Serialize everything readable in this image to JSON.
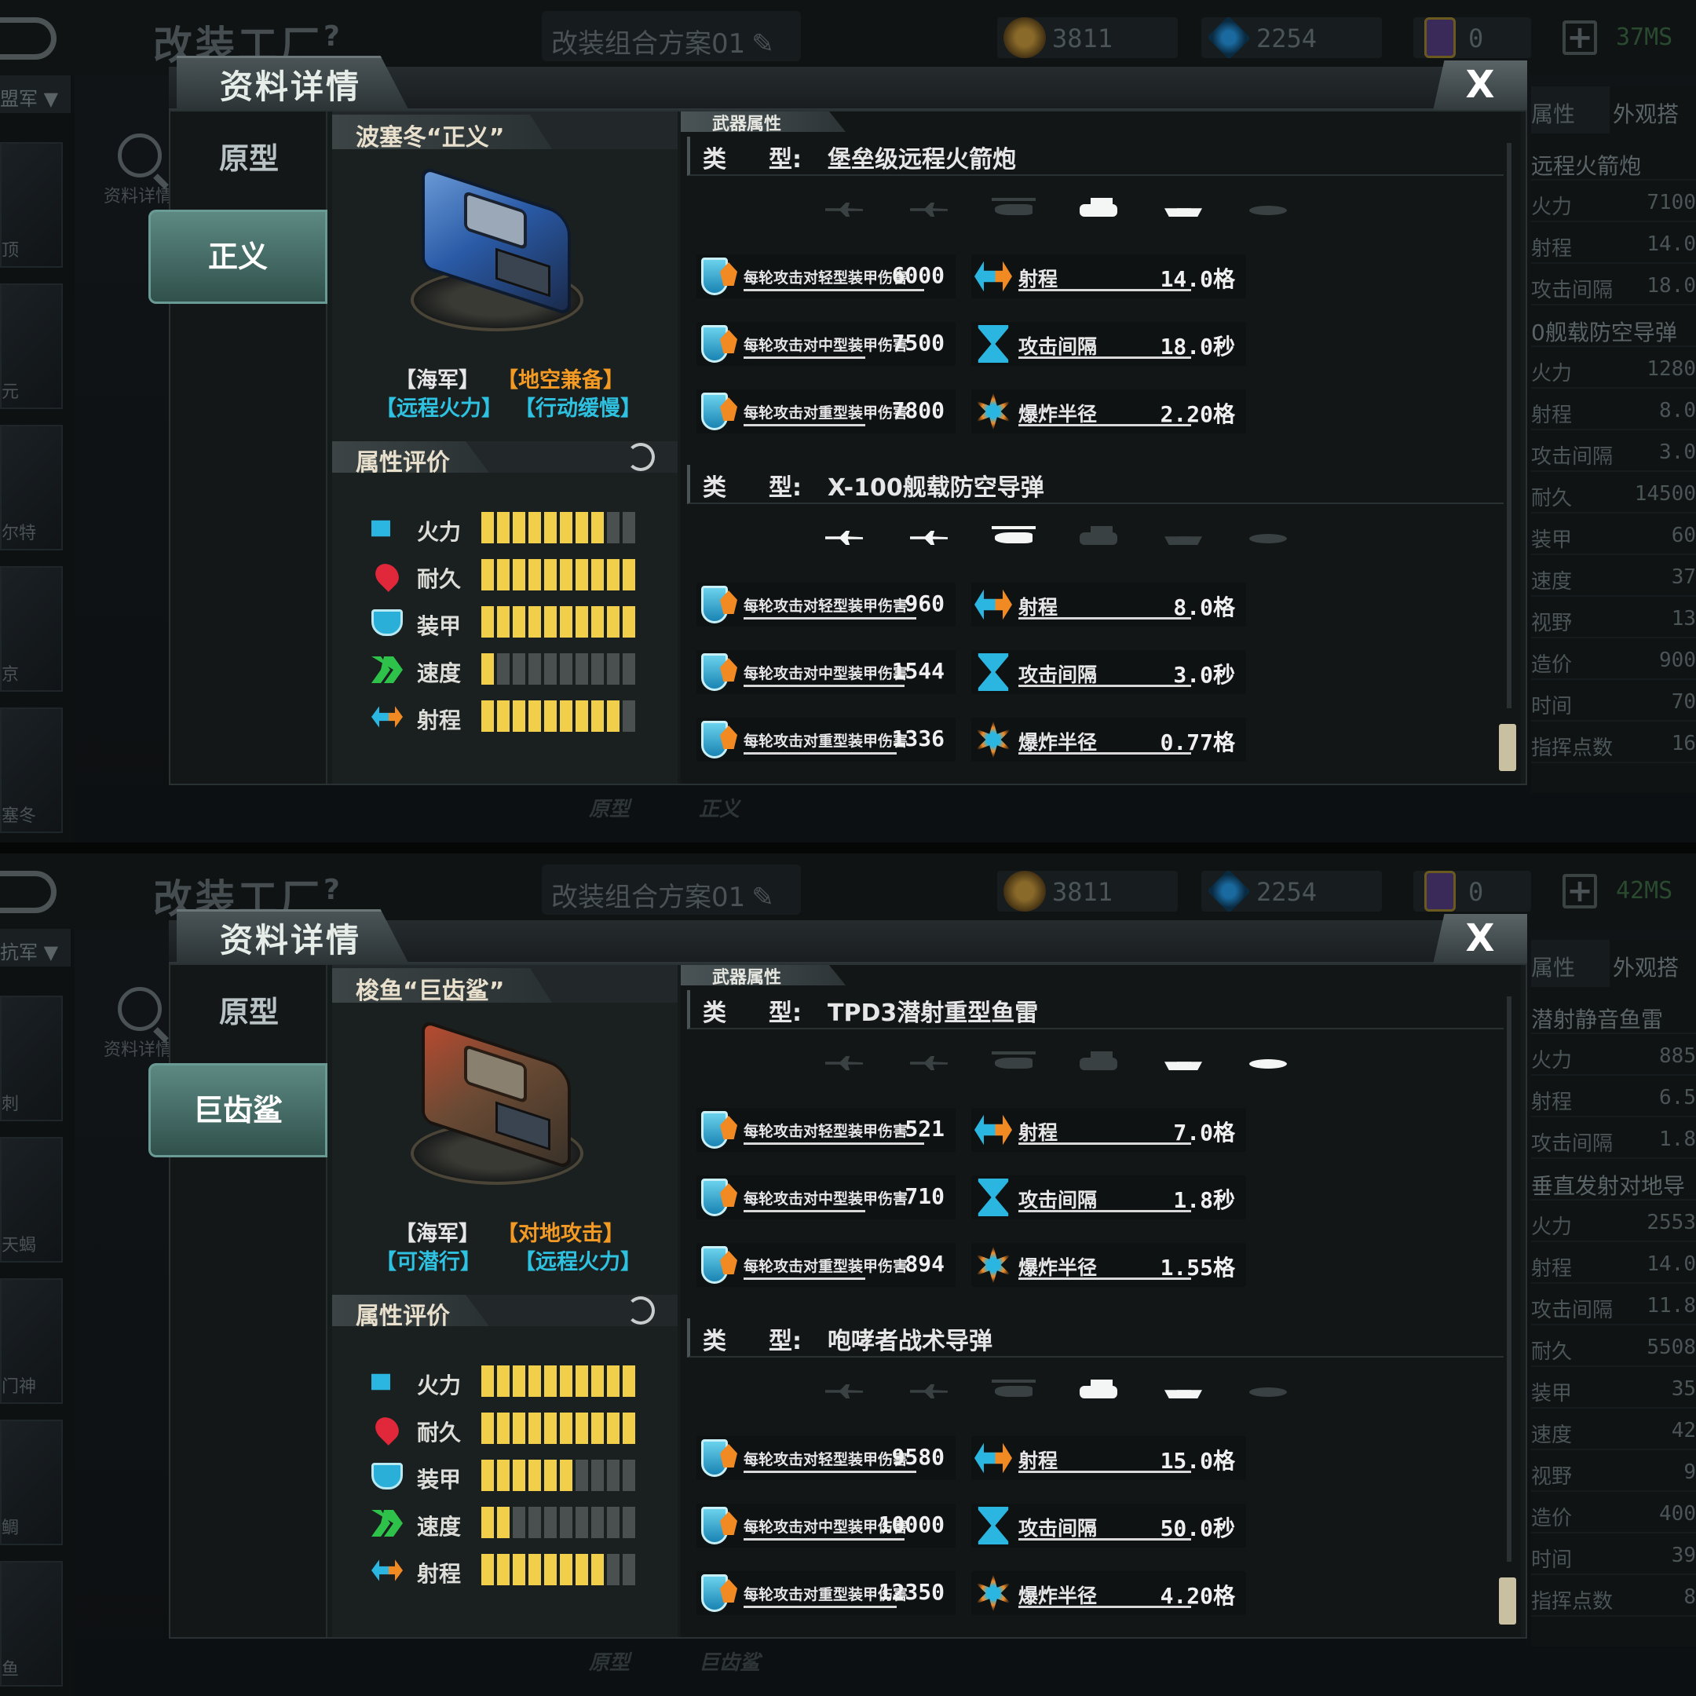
{
  "panels": [
    {
      "topbar": {
        "title": "改装工厂",
        "help": "?",
        "plan": "改装组合方案01",
        "gold": "3811",
        "gems": "2254",
        "cards": "0",
        "plus": "+",
        "net": "37MS"
      },
      "sidebar": {
        "faction": "盟军 ▼",
        "items": [
          "顶",
          "元",
          "尔特",
          "京",
          "塞冬"
        ]
      },
      "zoom_label": "资料详情",
      "dialog": {
        "title": "资料详情",
        "close": "X",
        "tab_proto": "原型",
        "tab_active": "正义",
        "unit_name": "波塞冬“正义”",
        "ship_color": "blue",
        "tags": [
          "【海军】",
          "【地空兼备】",
          "【远程火力】",
          "【行动缓慢】"
        ],
        "eval_title": "属性评价",
        "stats": [
          {
            "label": "火力",
            "level": 8
          },
          {
            "label": "耐久",
            "level": 10
          },
          {
            "label": "装甲",
            "level": 10
          },
          {
            "label": "速度",
            "level": 1
          },
          {
            "label": "射程",
            "level": 9
          }
        ],
        "weapon_header": "武器属性",
        "weapons": [
          {
            "type_key": "类",
            "type_key2": "型:",
            "type": "堡垒级远程火箭炮",
            "targets": [
              "off",
              "off",
              "off",
              "on",
              "on",
              "off"
            ],
            "rows": [
              {
                "llabel": "每轮攻击对轻型装甲伤害",
                "lval": "6000",
                "rlabel": "射程",
                "rval": "14.0格"
              },
              {
                "llabel": "每轮攻击对中型装甲伤害",
                "lval": "7500",
                "rlabel": "攻击间隔",
                "rval": "18.0秒"
              },
              {
                "llabel": "每轮攻击对重型装甲伤害",
                "lval": "7800",
                "rlabel": "爆炸半径",
                "rval": "2.20格"
              }
            ]
          },
          {
            "type_key": "类",
            "type_key2": "型:",
            "type": "X-100舰载防空导弹",
            "targets": [
              "on",
              "on",
              "on",
              "off",
              "off",
              "off"
            ],
            "rows": [
              {
                "llabel": "每轮攻击对轻型装甲伤害",
                "lval": "960",
                "rlabel": "射程",
                "rval": "8.0格"
              },
              {
                "llabel": "每轮攻击对中型装甲伤害",
                "lval": "1544",
                "rlabel": "攻击间隔",
                "rval": "3.0秒"
              },
              {
                "llabel": "每轮攻击对重型装甲伤害",
                "lval": "1336",
                "rlabel": "爆炸半径",
                "rval": "0.77格"
              }
            ]
          }
        ]
      },
      "rpanel": {
        "tab1": "属性",
        "tab2": "外观搭",
        "rows": [
          {
            "k": "远程火箭炮",
            "v": "",
            "head": true
          },
          {
            "k": "火力",
            "v": "7100"
          },
          {
            "k": "射程",
            "v": "14.0"
          },
          {
            "k": "攻击间隔",
            "v": "18.0"
          },
          {
            "k": "0舰载防空导弹",
            "v": "",
            "head": true
          },
          {
            "k": "火力",
            "v": "1280"
          },
          {
            "k": "射程",
            "v": "8.0"
          },
          {
            "k": "攻击间隔",
            "v": "3.0"
          },
          {
            "k": "耐久",
            "v": "14500"
          },
          {
            "k": "装甲",
            "v": "60"
          },
          {
            "k": "速度",
            "v": "37"
          },
          {
            "k": "视野",
            "v": "13"
          },
          {
            "k": "造价",
            "v": "900"
          },
          {
            "k": "时间",
            "v": "70"
          },
          {
            "k": "指挥点数",
            "v": "16"
          }
        ]
      },
      "bottom": [
        "原型",
        "正义"
      ]
    },
    {
      "topbar": {
        "title": "改装工厂",
        "help": "?",
        "plan": "改装组合方案01",
        "gold": "3811",
        "gems": "2254",
        "cards": "0",
        "plus": "+",
        "net": "42MS"
      },
      "sidebar": {
        "faction": "抗军 ▼",
        "items": [
          "刺",
          "天蝎",
          "门神",
          "鲷",
          "鱼"
        ]
      },
      "zoom_label": "资料详情",
      "dialog": {
        "title": "资料详情",
        "close": "X",
        "tab_proto": "原型",
        "tab_active": "巨齿鲨",
        "unit_name": "梭鱼“巨齿鲨”",
        "ship_color": "red",
        "tags": [
          "【海军】",
          "【对地攻击】",
          "【可潜行】",
          "【远程火力】"
        ],
        "eval_title": "属性评价",
        "stats": [
          {
            "label": "火力",
            "level": 10
          },
          {
            "label": "耐久",
            "level": 10
          },
          {
            "label": "装甲",
            "level": 6
          },
          {
            "label": "速度",
            "level": 2
          },
          {
            "label": "射程",
            "level": 8
          }
        ],
        "weapon_header": "武器属性",
        "weapons": [
          {
            "type_key": "类",
            "type_key2": "型:",
            "type": "TPD3潜射重型鱼雷",
            "targets": [
              "off",
              "off",
              "off",
              "off",
              "on",
              "on"
            ],
            "rows": [
              {
                "llabel": "每轮攻击对轻型装甲伤害",
                "lval": "521",
                "rlabel": "射程",
                "rval": "7.0格"
              },
              {
                "llabel": "每轮攻击对中型装甲伤害",
                "lval": "710",
                "rlabel": "攻击间隔",
                "rval": "1.8秒"
              },
              {
                "llabel": "每轮攻击对重型装甲伤害",
                "lval": "894",
                "rlabel": "爆炸半径",
                "rval": "1.55格"
              }
            ]
          },
          {
            "type_key": "类",
            "type_key2": "型:",
            "type": "咆哮者战术导弹",
            "targets": [
              "off",
              "off",
              "off",
              "on",
              "on",
              "off"
            ],
            "rows": [
              {
                "llabel": "每轮攻击对轻型装甲伤害",
                "lval": "9580",
                "rlabel": "射程",
                "rval": "15.0格"
              },
              {
                "llabel": "每轮攻击对中型装甲伤害",
                "lval": "10000",
                "rlabel": "攻击间隔",
                "rval": "50.0秒"
              },
              {
                "llabel": "每轮攻击对重型装甲伤害",
                "lval": "12350",
                "rlabel": "爆炸半径",
                "rval": "4.20格"
              }
            ]
          }
        ]
      },
      "rpanel": {
        "tab1": "属性",
        "tab2": "外观搭",
        "rows": [
          {
            "k": "潜射静音鱼雷",
            "v": "",
            "head": true
          },
          {
            "k": "火力",
            "v": "885"
          },
          {
            "k": "射程",
            "v": "6.5"
          },
          {
            "k": "攻击间隔",
            "v": "1.8"
          },
          {
            "k": "垂直发射对地导",
            "v": "",
            "head": true
          },
          {
            "k": "火力",
            "v": "2553"
          },
          {
            "k": "射程",
            "v": "14.0"
          },
          {
            "k": "攻击间隔",
            "v": "11.8"
          },
          {
            "k": "耐久",
            "v": "5508"
          },
          {
            "k": "装甲",
            "v": "35"
          },
          {
            "k": "速度",
            "v": "42"
          },
          {
            "k": "视野",
            "v": "9"
          },
          {
            "k": "造价",
            "v": "400"
          },
          {
            "k": "时间",
            "v": "39"
          },
          {
            "k": "指挥点数",
            "v": "8"
          }
        ]
      },
      "bottom": [
        "原型",
        "巨齿鲨"
      ]
    }
  ]
}
